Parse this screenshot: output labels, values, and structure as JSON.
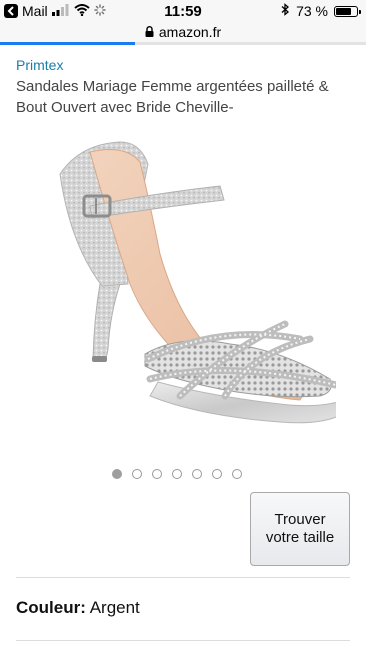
{
  "status_bar": {
    "back_app": "Mail",
    "time": "11:59",
    "battery": "73 %",
    "battery_level": 0.73
  },
  "browser": {
    "url": "amazon.fr",
    "load_progress": 0.37
  },
  "product": {
    "brand": "Primtex",
    "title": "Sandales Mariage Femme argentées pailleté & Bout Ouvert avec Bride Cheville-",
    "image_count": 7,
    "active_image": 0,
    "size_button_label": "Trouver votre taille",
    "color_label": "Couleur:",
    "color_value": "Argent"
  },
  "icons": [
    "back-icon",
    "signal-icon",
    "wifi-icon",
    "loading-icon",
    "bluetooth-icon",
    "battery-icon",
    "lock-icon"
  ]
}
